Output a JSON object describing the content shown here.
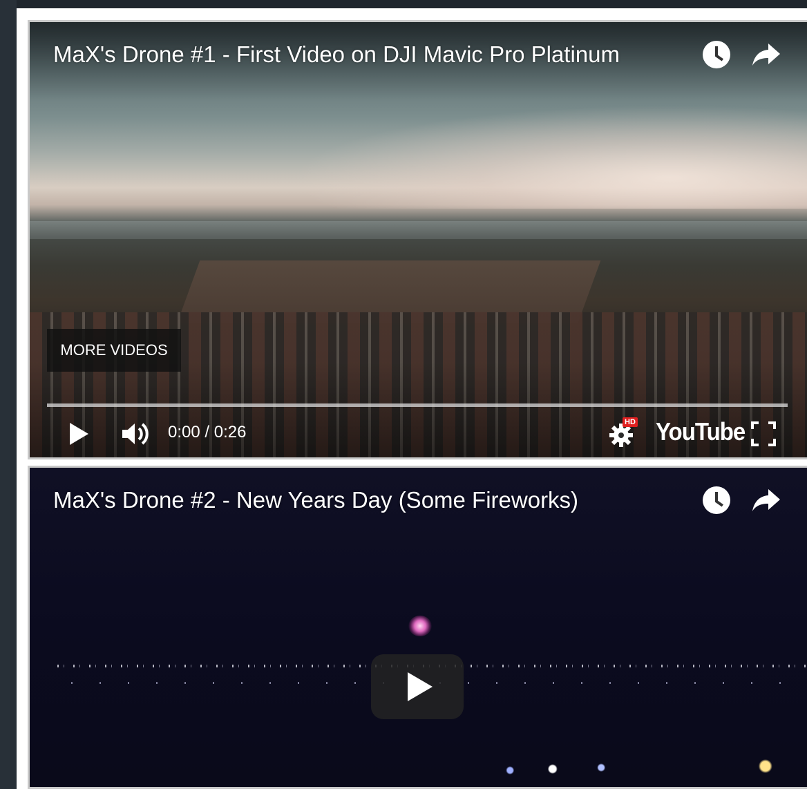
{
  "videos": [
    {
      "title": "MaX's Drone #1 - First Video on DJI Mavic Pro Platinum",
      "watch_later_icon": "clock-icon",
      "share_icon": "share-arrow-icon",
      "more_videos_label": "MORE VIDEOS",
      "progress": 0,
      "time_display": "0:00 / 0:26",
      "hd_badge": "HD",
      "brand_label": "YouTube"
    },
    {
      "title": "MaX's Drone #2 - New Years Day (Some Fireworks)",
      "watch_later_icon": "clock-icon",
      "share_icon": "share-arrow-icon",
      "play_icon": "play-icon"
    }
  ],
  "colors": {
    "page_background": "#283038",
    "panel_background": "#ffffff",
    "hd_badge": "#e02020"
  }
}
